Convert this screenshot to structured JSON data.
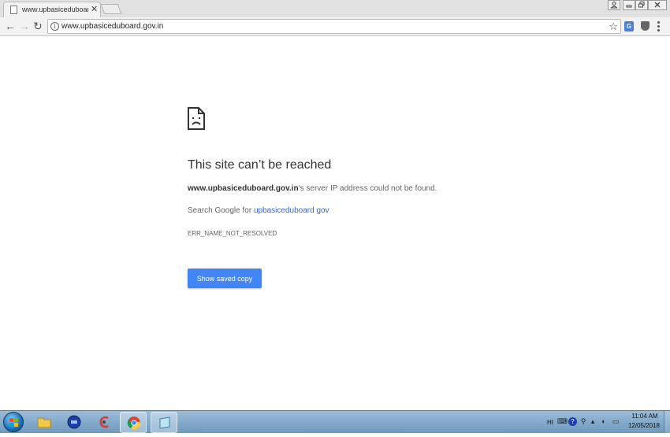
{
  "browser": {
    "tab": {
      "title": "www.upbasiceduboard.gov.in",
      "close_glyph": "✕"
    },
    "window_controls": {
      "user": "⍝",
      "minimize": "▭",
      "restore": "◰",
      "close": "✕"
    },
    "nav": {
      "back": "←",
      "forward": "→",
      "reload": "↻"
    },
    "address": {
      "url": "www.upbasiceduboard.gov.in",
      "info_glyph": "i",
      "star_glyph": "☆"
    },
    "extensions": {
      "translate_glyph": "G"
    },
    "accent_color": "#4285f4"
  },
  "error_page": {
    "title": "This site can’t be reached",
    "domain": "www.upbasiceduboard.gov.in",
    "description_suffix": "’s server IP address could not be found.",
    "search_prefix": "Search Google for ",
    "search_link": "upbasiceduboard gov",
    "error_code": "ERR_NAME_NOT_RESOLVED",
    "button_label": "Show saved copy",
    "icon": "sad-document-icon"
  },
  "taskbar": {
    "items": [
      {
        "name": "file-explorer",
        "icon": "folder-icon"
      },
      {
        "name": "media-app",
        "icon": "blue-disc-icon"
      },
      {
        "name": "cleaner-app",
        "icon": "swirl-icon"
      },
      {
        "name": "chrome",
        "icon": "chrome-icon",
        "active": true
      },
      {
        "name": "window-app",
        "icon": "window-icon",
        "active": true
      }
    ],
    "tray": {
      "language": "HI",
      "clock_time": "11:04 AM",
      "clock_date": "12/05/2018"
    }
  }
}
